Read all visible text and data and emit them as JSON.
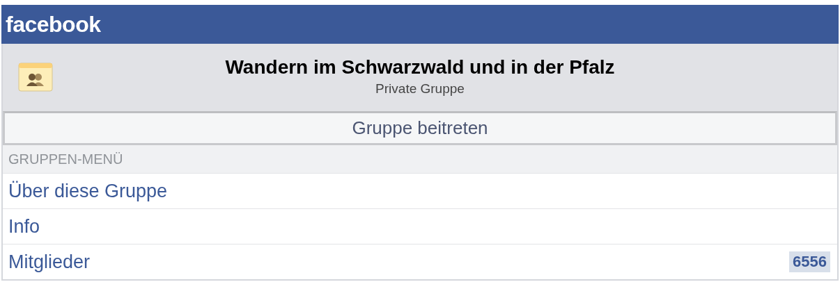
{
  "header": {
    "logo": "facebook"
  },
  "group": {
    "name": "Wandern im Schwarzwald und in der Pfalz",
    "privacy": "Private Gruppe"
  },
  "join_button": {
    "label": "Gruppe beitreten"
  },
  "menu": {
    "title": "GRUPPEN-MENÜ",
    "items": [
      {
        "label": "Über diese Gruppe"
      },
      {
        "label": "Info"
      },
      {
        "label": "Mitglieder",
        "count": "6556"
      }
    ]
  }
}
